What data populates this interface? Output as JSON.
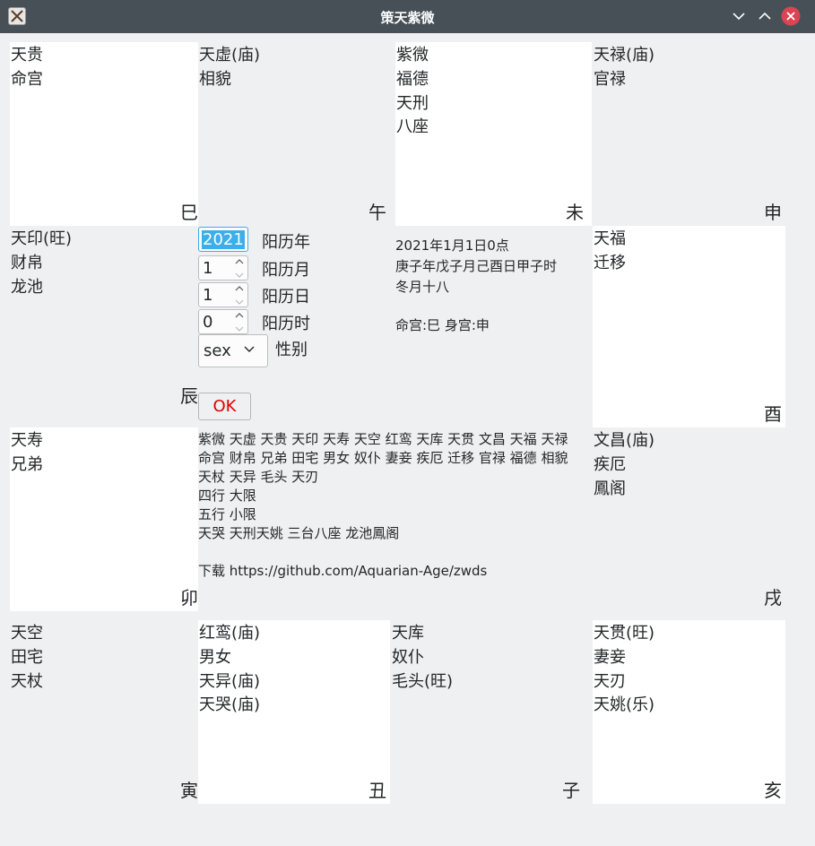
{
  "window": {
    "title": "策天紫微"
  },
  "palaces": {
    "si": {
      "stars": [
        "天贵",
        "命宫"
      ],
      "branch": "巳"
    },
    "wu": {
      "stars": [
        "天虚(庙)",
        "相貌"
      ],
      "branch": "午"
    },
    "wei": {
      "stars": [
        "紫微",
        "福德",
        "天刑",
        "八座"
      ],
      "branch": "未"
    },
    "shen": {
      "stars": [
        "天禄(庙)",
        "官禄"
      ],
      "branch": "申"
    },
    "chen": {
      "stars": [
        "天印(旺)",
        "财帛",
        "龙池"
      ],
      "branch": "辰"
    },
    "you": {
      "stars": [
        "天福",
        "迁移"
      ],
      "branch": "酉"
    },
    "mao": {
      "stars": [
        "天寿",
        "兄弟"
      ],
      "branch": "卯"
    },
    "xu": {
      "stars": [
        "文昌(庙)",
        "疾厄",
        "鳳阁"
      ],
      "branch": "戌"
    },
    "yin": {
      "stars": [
        "天空",
        "田宅",
        "天杖"
      ],
      "branch": "寅"
    },
    "chou": {
      "stars": [
        "红鸾(庙)",
        "男女",
        "天异(庙)",
        "天哭(庙)"
      ],
      "branch": "丑"
    },
    "zi": {
      "stars": [
        "天库",
        "奴仆",
        "毛头(旺)"
      ],
      "branch": "子"
    },
    "hai": {
      "stars": [
        "天贯(旺)",
        "妻妾",
        "天刃",
        "天姚(乐)"
      ],
      "branch": "亥"
    }
  },
  "form": {
    "year": {
      "value": "2021",
      "label": "阳历年"
    },
    "month": {
      "value": "1",
      "label": "阳历月"
    },
    "day": {
      "value": "1",
      "label": "阳历日"
    },
    "hour": {
      "value": "0",
      "label": "阳历时"
    },
    "sex": {
      "value": "sex",
      "label": "性别"
    },
    "ok_label": "OK"
  },
  "info": {
    "date": "2021年1月1日0点",
    "ganzhi": "庚子年戊子月己酉日甲子时",
    "lunar": "冬月十八",
    "palace": "命宫:巳 身宫:申"
  },
  "legend": {
    "line1": "紫微 天虚 天贵 天印 天寿 天空 红鸾 天库 天贯 文昌 天福 天禄",
    "line2": "命宫 财帛 兄弟 田宅 男女 奴仆 妻妾 疾厄 迁移 官禄 福德 相貌",
    "line3": "天杖 天异 毛头 天刃",
    "line4": "四行 大限",
    "line5": "五行 小限",
    "line6": "天哭 天刑天姚 三台八座 龙池鳳阁",
    "download": "下载 https://github.com/Aquarian-Age/zwds"
  },
  "colors": {
    "titlebar": "#475057",
    "close": "#da4453",
    "ok_text": "#e00000",
    "focus": "#3daee9"
  }
}
